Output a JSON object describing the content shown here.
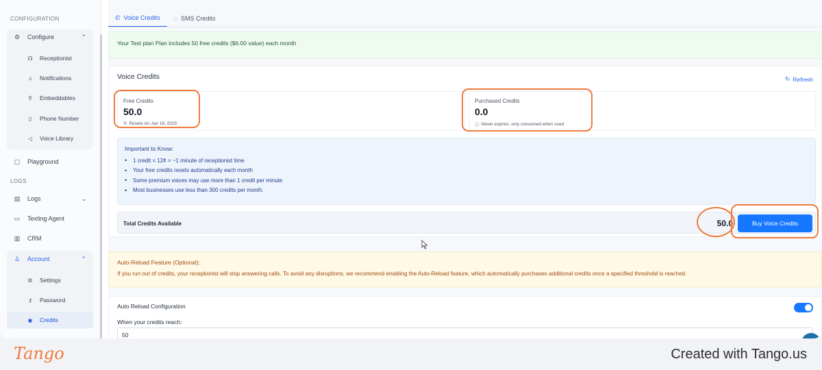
{
  "sidebar": {
    "section_configuration": "CONFIGURATION",
    "configure_label": "Configure",
    "configure_items": [
      {
        "label": "Receptionist",
        "icon": "headset-icon"
      },
      {
        "label": "Notifications",
        "icon": "bell-icon"
      },
      {
        "label": "Embeddables",
        "icon": "puzzle-icon"
      },
      {
        "label": "Phone Number",
        "icon": "phone-icon"
      },
      {
        "label": "Voice Library",
        "icon": "speaker-icon"
      }
    ],
    "playground_label": "Playground",
    "section_logs": "LOGS",
    "logs_label": "Logs",
    "texting_agent_label": "Texting Agent",
    "crm_label": "CRM",
    "account_label": "Account",
    "account_items": [
      {
        "label": "Settings",
        "icon": "gear-icon"
      },
      {
        "label": "Password",
        "icon": "key-icon"
      },
      {
        "label": "Credits",
        "icon": "coin-icon"
      }
    ]
  },
  "tabs": [
    {
      "label": "Voice Credits",
      "icon": "phone-icon",
      "active": true
    },
    {
      "label": "SMS Credits",
      "icon": "message-icon",
      "active": false
    }
  ],
  "plan_banner": "Your Test plan Plan includes 50 free credits ($6.00 value) each month",
  "voice_credits": {
    "title": "Voice Credits",
    "refresh_label": "Refresh",
    "free": {
      "label": "Free Credits",
      "value": "50.0",
      "note": "Resets on: Apr 18, 2025"
    },
    "purchased": {
      "label": "Purchased Credits",
      "value": "0.0",
      "note": "Never expires, only consumed when used"
    },
    "info_title": "Important to Know:",
    "info_items": [
      "1 credit = 12¢ = ~1 minute of receptionist time",
      "Your free credits resets automatically each month",
      "Some premium voices may use more than 1 credit per minute",
      "Most businesses use less than 300 credits per month."
    ],
    "total_label": "Total Credits Available",
    "total_value": "50.0",
    "buy_label": "Buy Voice Credits"
  },
  "auto_reload_banner": {
    "title": "Auto-Reload Feature (Optional):",
    "text": "If you run out of credits, your receptionist will stop answering calls. To avoid any disruptions, we recommend enabling the Auto-Reload feature, which automatically purchases additional credits once a specified threshold is reached."
  },
  "auto_reload_config": {
    "title": "Auto Reload Configuration",
    "enabled": true,
    "threshold_label": "When your credits reach:",
    "threshold_value": "50"
  },
  "footer": {
    "logo_text": "Tango",
    "created_text": "Created with Tango.us"
  },
  "colors": {
    "accent": "#1677ff",
    "highlight": "#ee7a3b",
    "success_bg": "#effaf1",
    "warning_bg": "#fff9e6"
  }
}
